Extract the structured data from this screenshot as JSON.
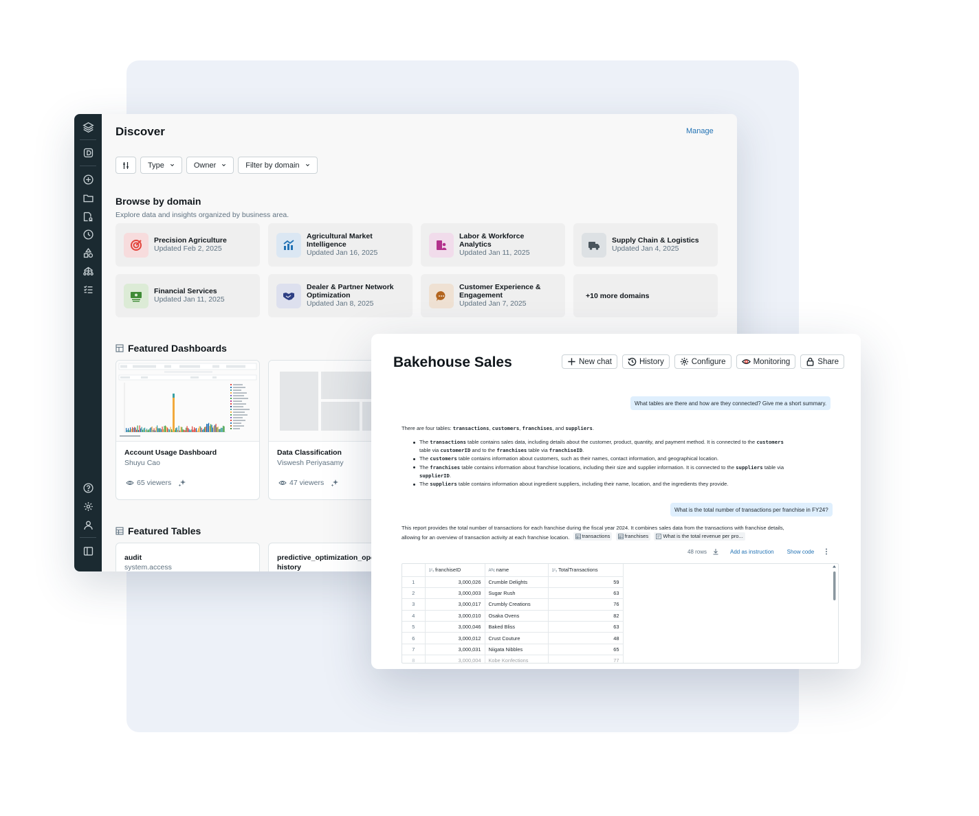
{
  "discover": {
    "title": "Discover",
    "manage_label": "Manage",
    "filters": [
      {
        "label": "Type"
      },
      {
        "label": "Owner"
      },
      {
        "label": "Filter by domain"
      }
    ],
    "browse": {
      "title": "Browse by domain",
      "subtitle": "Explore data and insights organized by business area.",
      "domains": [
        {
          "name": "Precision Agriculture",
          "updated": "Updated Feb 2, 2025",
          "icon": "target-icon",
          "color": "#e2453c",
          "bg": "#f7dcdd"
        },
        {
          "name": "Agricultural Market Intelligence",
          "updated": "Updated Jan 16, 2025",
          "icon": "market-chart-icon",
          "color": "#2272b4",
          "bg": "#dbe7f3"
        },
        {
          "name": "Labor & Workforce Analytics",
          "updated": "Updated Jan 11, 2025",
          "icon": "workforce-icon",
          "color": "#b3318c",
          "bg": "#f1dceb"
        },
        {
          "name": "Supply Chain & Logistics",
          "updated": "Updated Jan 4, 2025",
          "icon": "truck-icon",
          "color": "#4a555d",
          "bg": "#dde1e4"
        },
        {
          "name": "Financial Services",
          "updated": "Updated Jan 11, 2025",
          "icon": "money-icon",
          "color": "#3f8b36",
          "bg": "#dcebd6"
        },
        {
          "name": "Dealer & Partner Network Optimization",
          "updated": "Updated Jan 8, 2025",
          "icon": "handshake-icon",
          "color": "#2e3f84",
          "bg": "#dde0ee"
        },
        {
          "name": "Customer Experience & Engagement",
          "updated": "Updated Jan 7, 2025",
          "icon": "chat-bubble-icon",
          "color": "#b3651f",
          "bg": "#efe1d3"
        }
      ],
      "more_label": "+10 more domains"
    },
    "dashboards": {
      "title": "Featured Dashboards",
      "items": [
        {
          "name": "Account Usage Dashboard",
          "owner": "Shuyu Cao",
          "viewers": "65 viewers"
        },
        {
          "name": "Data Classification",
          "owner": "Viswesh Periyasamy",
          "viewers": "47 viewers"
        }
      ]
    },
    "tables": {
      "title": "Featured Tables",
      "items": [
        {
          "name": "audit",
          "schema": "system.access"
        },
        {
          "name": "predictive_optimization_ope",
          "schema": "history"
        }
      ]
    }
  },
  "genie": {
    "title": "Bakehouse Sales",
    "buttons": {
      "new_chat": "New chat",
      "history": "History",
      "configure": "Configure",
      "monitoring": "Monitoring",
      "share": "Share"
    },
    "q1": "What tables are there and how are they connected? Give me a short summary.",
    "a1": {
      "intro_pre": "There are four tables: ",
      "t_transactions": "transactions",
      "t_customers": "customers",
      "t_franchises": "franchises",
      "t_suppliers": "suppliers",
      "and": ", and ",
      "comma": ", ",
      "period": ".",
      "b1_a": "The ",
      "b1_b": " table contains sales data, including details about the customer, product, quantity, and payment method. It is connected to the ",
      "b1_c": "table via ",
      "customerID": "customerID",
      "b1_d": " and to the ",
      "b1_e": " table via ",
      "franchiseID": "franchiseID",
      "b2_a": "The ",
      "b2_b": " table contains information about customers, such as their names, contact information, and geographical location.",
      "b3_a": "The ",
      "b3_b": " table contains information about franchise locations, including their size and supplier information. It is connected to the ",
      "b3_c": " table via",
      "supplierID": "supplierID",
      "b4_a": "The ",
      "b4_b": " table contains information about ingredient suppliers, including their name, location, and the ingredients they provide."
    },
    "q2": "What is the total number of transactions per franchise in FY24?",
    "a2": {
      "line1": "This report provides the total number of transactions for each franchise during the fiscal year 2024. It combines sales data from the transactions with franchise details,",
      "line2": "allowing for an overview of transaction activity at each franchise location.",
      "refs": [
        "transactions",
        "franchises",
        "What is the total revenue per pro..."
      ]
    },
    "toolbar": {
      "rows": "48 rows",
      "add_instruction": "Add as instruction",
      "show_code": "Show code"
    },
    "table": {
      "columns": [
        "franchiseID",
        "name",
        "TotalTransactions"
      ],
      "rows": [
        {
          "i": "1",
          "id": "3,000,026",
          "name": "Crumble Delights",
          "total": "59"
        },
        {
          "i": "2",
          "id": "3,000,003",
          "name": "Sugar Rush",
          "total": "63"
        },
        {
          "i": "3",
          "id": "3,000,017",
          "name": "Crumbly Creations",
          "total": "76"
        },
        {
          "i": "4",
          "id": "3,000,010",
          "name": "Osaka Ovens",
          "total": "82"
        },
        {
          "i": "5",
          "id": "3,000,046",
          "name": "Baked Bliss",
          "total": "63"
        },
        {
          "i": "6",
          "id": "3,000,012",
          "name": "Crust Couture",
          "total": "48"
        },
        {
          "i": "7",
          "id": "3,000,031",
          "name": "Niigata Nibbles",
          "total": "65"
        },
        {
          "i": "8",
          "id": "3,000,004",
          "name": "Kobe Konfections",
          "total": "77"
        }
      ]
    }
  }
}
